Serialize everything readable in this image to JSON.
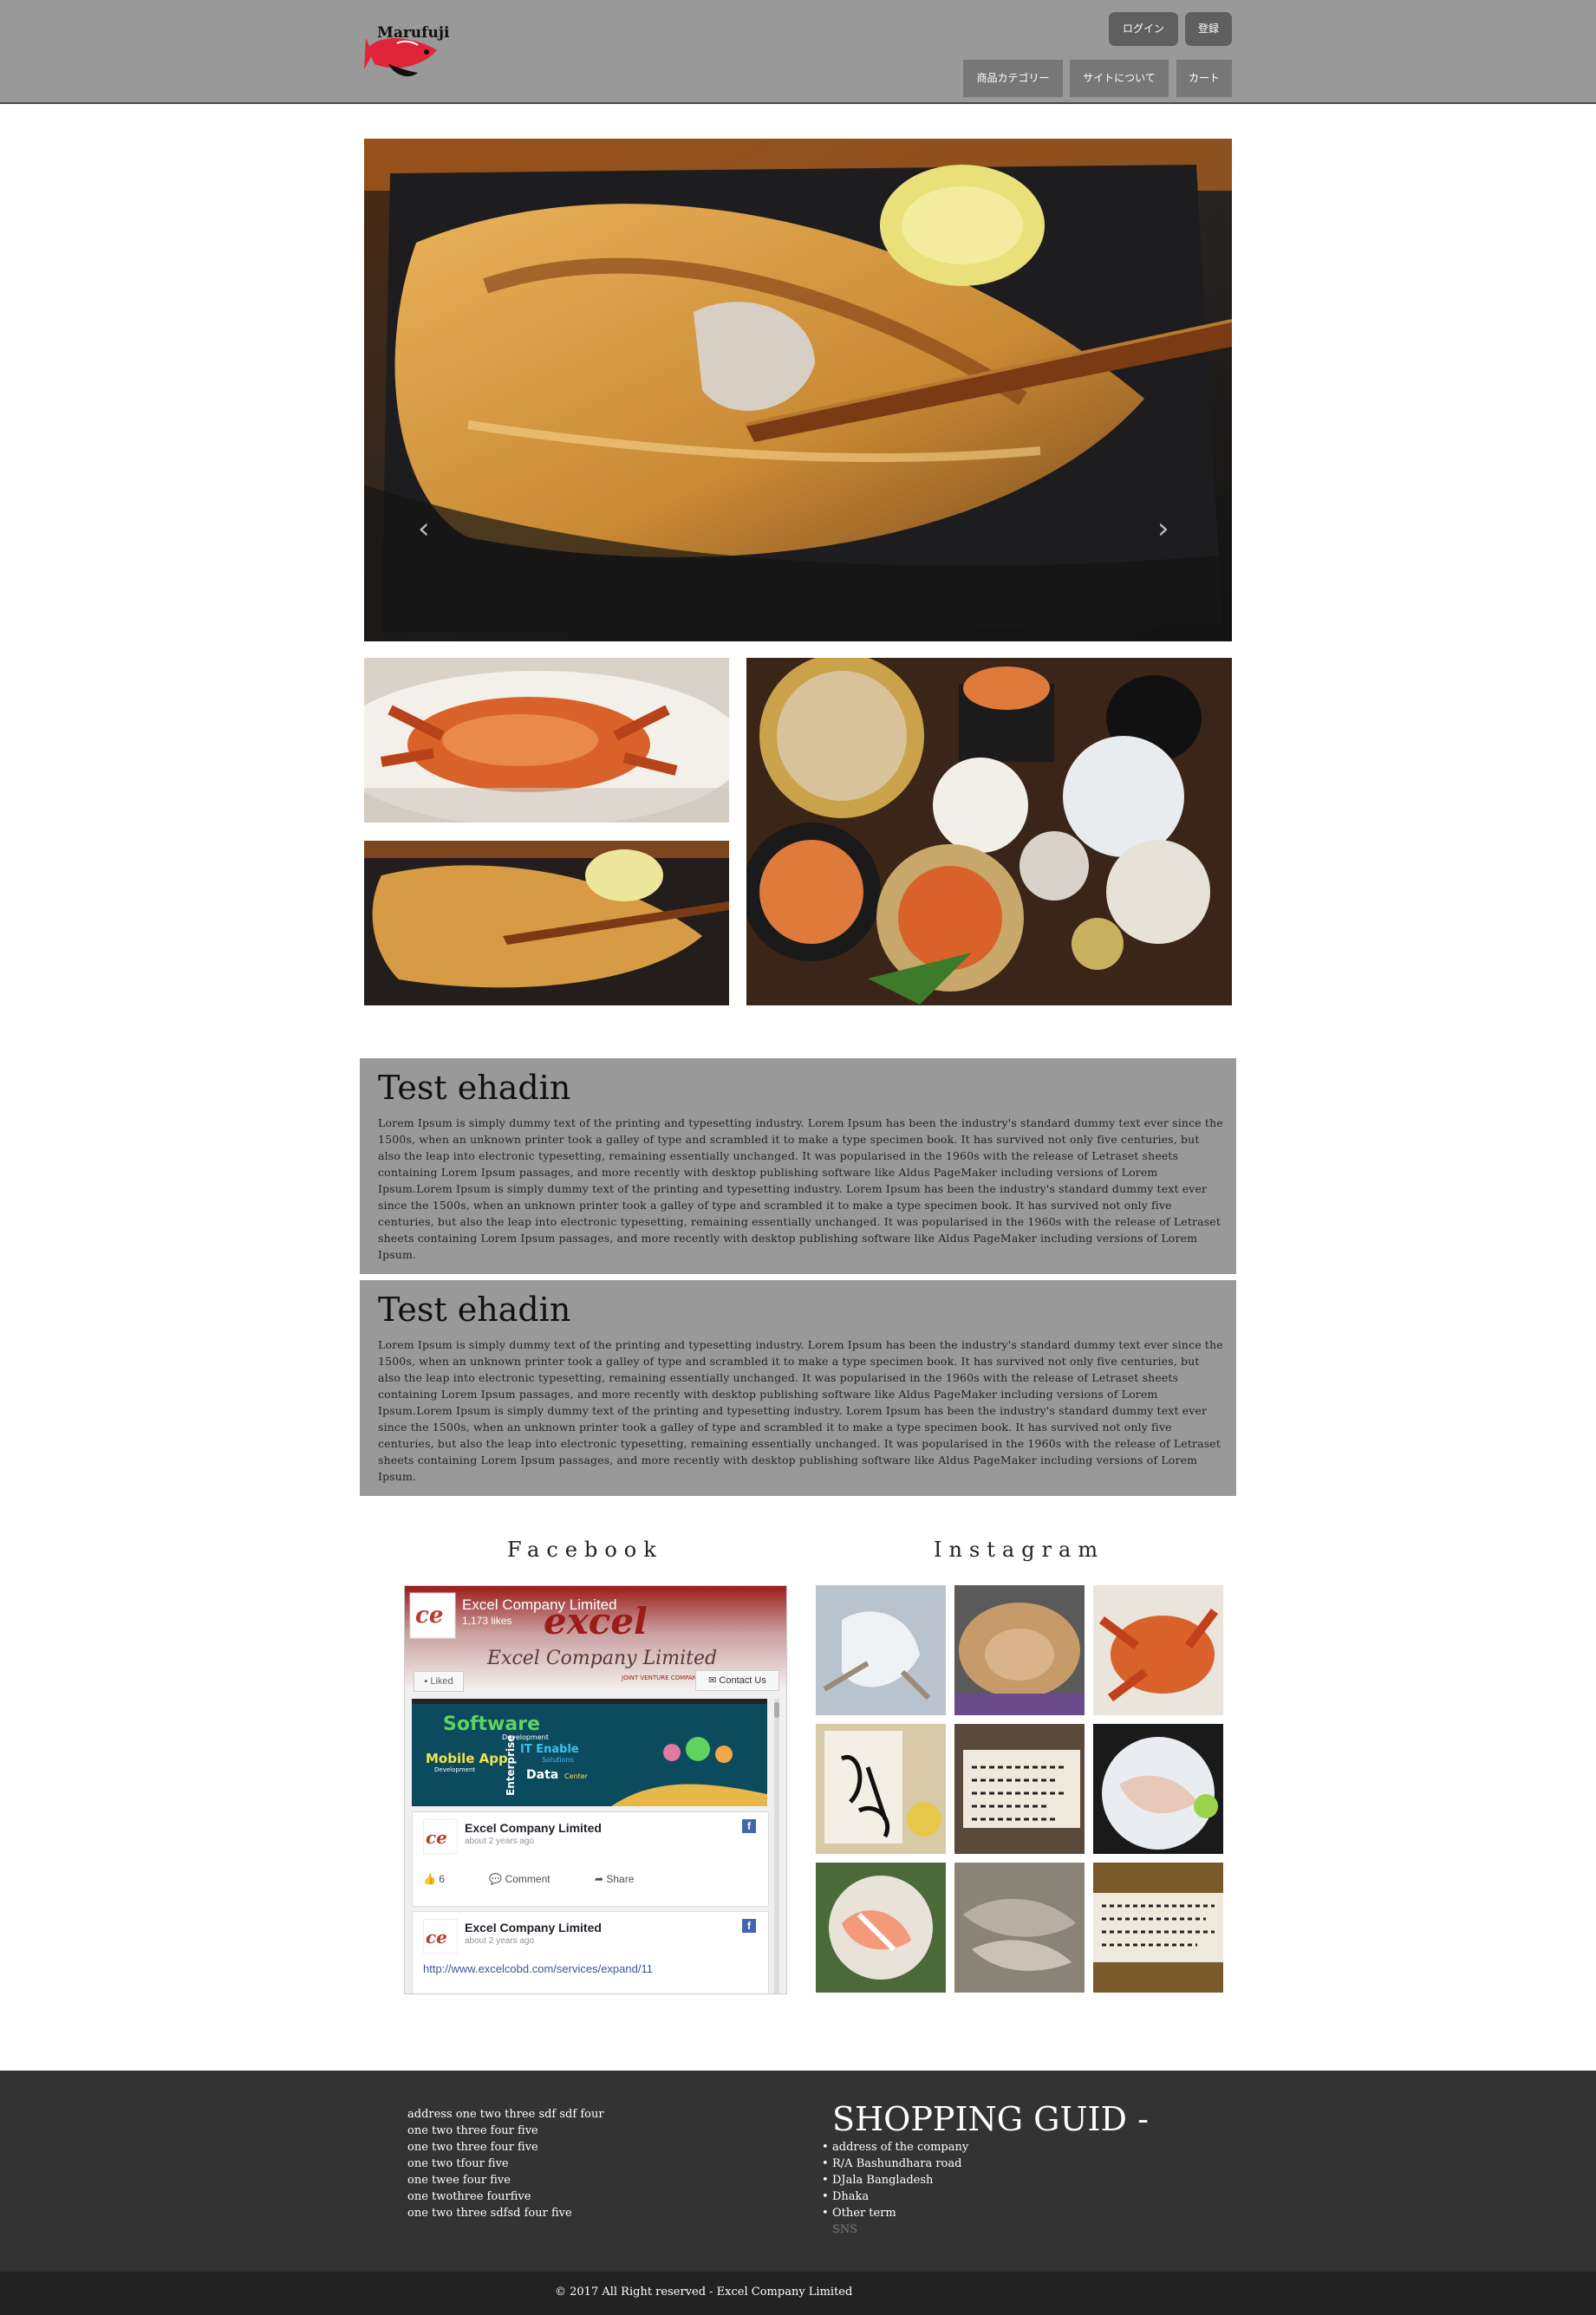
{
  "header": {
    "logo_text": "Marufuji",
    "login_label": "ログイン",
    "register_label": "登録",
    "nav": [
      "商品カテゴリー",
      "サイトについて",
      "カート"
    ]
  },
  "hero": {
    "prev_icon": "chevron-left-icon",
    "next_icon": "chevron-right-icon",
    "slide_count": 3,
    "active_slide": 3
  },
  "articles": [
    {
      "title": "Test ehadin",
      "body": "Lorem Ipsum is simply dummy text of the printing and typesetting industry. Lorem Ipsum has been the industry's standard dummy text ever since the 1500s, when an unknown printer took a galley of type and scrambled it to make a type specimen book. It has survived not only five centuries, but also the leap into electronic typesetting, remaining essentially unchanged. It was popularised in the 1960s with the release of Letraset sheets containing Lorem Ipsum passages, and more recently with desktop publishing software like Aldus PageMaker including versions of Lorem Ipsum.Lorem Ipsum is simply dummy text of the printing and typesetting industry. Lorem Ipsum has been the industry's standard dummy text ever since the 1500s, when an unknown printer took a galley of type and scrambled it to make a type specimen book. It has survived not only five centuries, but also the leap into electronic typesetting, remaining essentially unchanged. It was popularised in the 1960s with the release of Letraset sheets containing Lorem Ipsum passages, and more recently with desktop publishing software like Aldus PageMaker including versions of Lorem Ipsum."
    },
    {
      "title": "Test ehadin",
      "body": "Lorem Ipsum is simply dummy text of the printing and typesetting industry. Lorem Ipsum has been the industry's standard dummy text ever since the 1500s, when an unknown printer took a galley of type and scrambled it to make a type specimen book. It has survived not only five centuries, but also the leap into electronic typesetting, remaining essentially unchanged. It was popularised in the 1960s with the release of Letraset sheets containing Lorem Ipsum passages, and more recently with desktop publishing software like Aldus PageMaker including versions of Lorem Ipsum.Lorem Ipsum is simply dummy text of the printing and typesetting industry. Lorem Ipsum has been the industry's standard dummy text ever since the 1500s, when an unknown printer took a galley of type and scrambled it to make a type specimen book. It has survived not only five centuries, but also the leap into electronic typesetting, remaining essentially unchanged. It was popularised in the 1960s with the release of Letraset sheets containing Lorem Ipsum passages, and more recently with desktop publishing software like Aldus PageMaker including versions of Lorem Ipsum."
    }
  ],
  "social": {
    "facebook_title": "Facebook",
    "instagram_title": "Instagram",
    "fb": {
      "page_name": "Excel Company Limited",
      "likes": "1,173 likes",
      "banner_text": "Excel Company Limited",
      "banner_sub": "JOINT VENTURE COMPANY",
      "liked_label": "Liked",
      "contact_label": "Contact Us",
      "post_img_words": [
        "Software",
        "Development",
        "Mobile App",
        "Development",
        "Enterprise",
        "IT Enable",
        "Solutions",
        "Data",
        "Center"
      ],
      "posts": [
        {
          "name": "Excel Company Limited",
          "time": "about 2 years ago",
          "likes": "6",
          "comment": "Comment",
          "share": "Share"
        },
        {
          "name": "Excel Company Limited",
          "time": "about 2 years ago",
          "link": "http://www.excelcobd.com/services/expand/11"
        }
      ]
    },
    "instagram_icons": [
      "crab-shell-photo",
      "crab-photo",
      "crab-photo",
      "calligraphy-photo",
      "handwritten-menu-photo",
      "sashimi-photo",
      "sashimi-photo",
      "fish-photo",
      "handwritten-menu-photo"
    ]
  },
  "footer": {
    "address_lines": [
      "address one two three sdf sdf four",
      "one two three four five",
      "one two three four five",
      "one two tfour five",
      "one twee four five",
      "one twothree fourfive",
      "one two three sdfsd four five"
    ],
    "guide_title": "SHOPPING GUID -",
    "guide_items": [
      "address of the company",
      "R/A Bashundhara road",
      "DJala Bangladesh",
      "Dhaka",
      "Other term",
      "SNS"
    ],
    "copyright": "© 2017 All Right reserved - Excel Company Limited"
  },
  "colors": {
    "header_bg": "#999999",
    "article_bg": "#999999",
    "footer_bg": "#333333",
    "bottombar_bg": "#222222",
    "brand_red": "#e0243a"
  }
}
